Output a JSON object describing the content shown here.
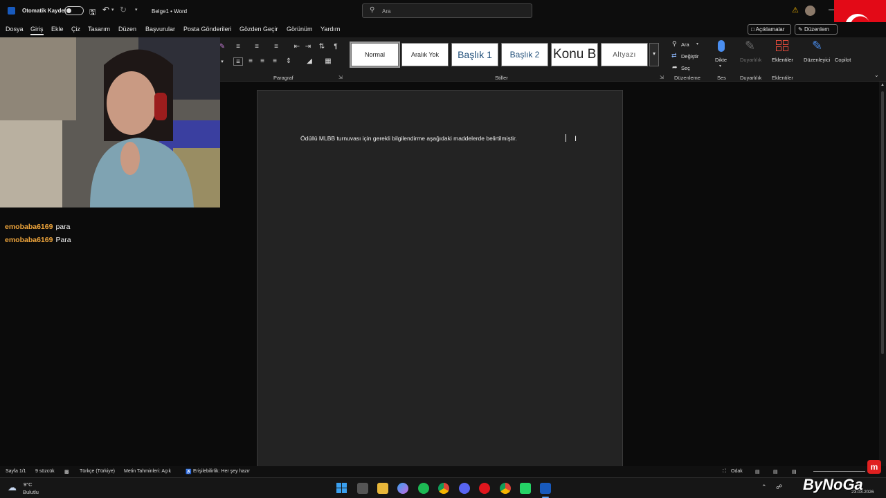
{
  "titlebar": {
    "autosave_label": "Otomatik Kaydet",
    "document_title": "Belge1 • Word",
    "search_placeholder": "Ara"
  },
  "menu": {
    "items": [
      "Dosya",
      "Giriş",
      "Ekle",
      "Çiz",
      "Tasarım",
      "Düzen",
      "Başvurular",
      "Posta Gönderileri",
      "Gözden Geçir",
      "Görünüm",
      "Yardım"
    ],
    "active": "Giriş",
    "comments_button": "Açıklamalar",
    "editing_button": "Düzenlem"
  },
  "ribbon": {
    "paragraph_label": "Paragraf",
    "styles_label": "Stiller",
    "styles": [
      "Normal",
      "Aralık Yok",
      "Başlık 1",
      "Başlık 2",
      "Konu B",
      "Altyazı"
    ],
    "find_label": "Ara",
    "replace_label": "Değiştir",
    "select_label": "Seç",
    "editing_label": "Düzenleme",
    "dictate_label": "Dikte",
    "voice_label": "Ses",
    "sensitivity_label": "Duyarlılık",
    "sensitivity_group": "Duyarlılık",
    "addins_label": "Eklentiler",
    "addins_group": "Eklentiler",
    "editor_label": "Düzenleyici",
    "copilot_label": "Copilot"
  },
  "document": {
    "text": "Ödüllü MLBB turnuvası için gerekli bilgilendirme aşağıdaki maddelerde belirtilmiştir."
  },
  "chat": [
    {
      "user": "emobaba6169",
      "message": "para"
    },
    {
      "user": "emobaba6169",
      "message": "Para"
    }
  ],
  "statusbar": {
    "page": "Sayfa 1/1",
    "words": "9 sözcük",
    "language": "Türkçe (Türkiye)",
    "predictions": "Metin Tahminleri: Açık",
    "accessibility": "Erişilebilirlik: Her şey hazır",
    "focus": "Odak"
  },
  "taskbar": {
    "weather_temp": "9°C",
    "weather_desc": "Bulutlu",
    "date": "23.03.2026",
    "watermark": "ByNoGa"
  },
  "colors": {
    "accent": "#185abd",
    "chat_user": "#f0a63c"
  }
}
